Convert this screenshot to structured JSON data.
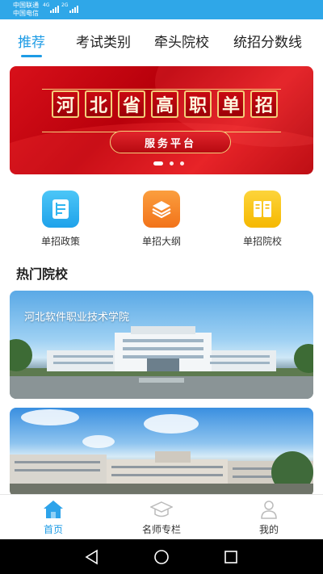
{
  "status_bar": {
    "carrier_1": "中国联通",
    "carrier_2": "中国电信",
    "net_1": "4G",
    "net_2": "2G"
  },
  "top_tabs": [
    {
      "label": "推荐",
      "active": true
    },
    {
      "label": "考试类别",
      "active": false
    },
    {
      "label": "牵头院校",
      "active": false
    },
    {
      "label": "统招分数线",
      "active": false
    }
  ],
  "banner": {
    "title_chars": [
      "河",
      "北",
      "省",
      "高",
      "职",
      "单",
      "招"
    ],
    "button_label": "服务平台",
    "page_count": 3,
    "active_page": 1
  },
  "quick_entries": [
    {
      "label": "单招政策",
      "icon": "document-icon",
      "color": "#2fb5f0"
    },
    {
      "label": "单招大纲",
      "icon": "layers-icon",
      "color": "#f7892b"
    },
    {
      "label": "单招院校",
      "icon": "book-icon",
      "color": "#f9c515"
    }
  ],
  "hot_schools": {
    "title": "热门院校",
    "cards": [
      {
        "name": "河北软件职业技术学院"
      },
      {
        "name": ""
      }
    ]
  },
  "bottom_nav": [
    {
      "label": "首页",
      "icon": "home-icon",
      "active": true
    },
    {
      "label": "名师专栏",
      "icon": "graduation-cap-icon",
      "active": false
    },
    {
      "label": "我的",
      "icon": "user-icon",
      "active": false
    }
  ],
  "colors": {
    "accent": "#1d9be5",
    "status_bar": "#2fa7e8",
    "banner_red": "#d8101a"
  }
}
